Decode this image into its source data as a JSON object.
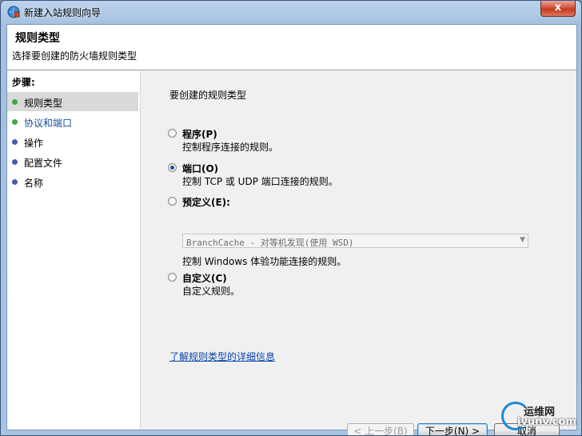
{
  "window": {
    "title": "新建入站规则向导",
    "close_label": "x"
  },
  "header": {
    "title": "规则类型",
    "subtitle": "选择要创建的防火墙规则类型"
  },
  "steps": {
    "title": "步骤:",
    "items": [
      {
        "label": "规则类型",
        "dot_color": "#3fa83f"
      },
      {
        "label": "协议和端口",
        "dot_color": "#3fa83f"
      },
      {
        "label": "操作",
        "dot_color": "#4a5ab4"
      },
      {
        "label": "配置文件",
        "dot_color": "#4a5ab4"
      },
      {
        "label": "名称",
        "dot_color": "#4a5ab4"
      }
    ]
  },
  "content": {
    "prompt": "要创建的规则类型",
    "options": [
      {
        "label": "程序(P)",
        "desc": "控制程序连接的规则。",
        "selected": false
      },
      {
        "label": "端口(O)",
        "desc": "控制 TCP 或 UDP 端口连接的规则。",
        "selected": true
      },
      {
        "label": "预定义(E):",
        "desc": "控制 Windows 体验功能连接的规则。",
        "selected": false
      },
      {
        "label": "自定义(C)",
        "desc": "自定义规则。",
        "selected": false
      }
    ],
    "predefined_select": "BranchCache - 对等机发现(使用 WSD)",
    "help_link": "了解规则类型的详细信息"
  },
  "buttons": {
    "back": "< 上一步(B)",
    "next": "下一步(N) >",
    "cancel": "取消"
  },
  "watermark": {
    "cn": "运维网",
    "en": "iyunv.com"
  }
}
